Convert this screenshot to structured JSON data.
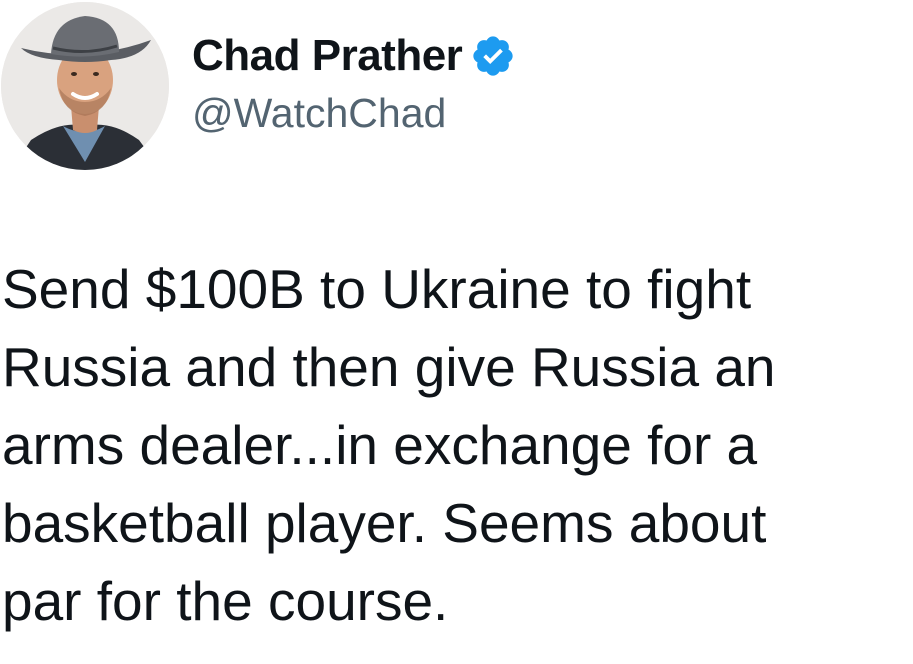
{
  "author": {
    "display_name": "Chad Prather",
    "handle": "@WatchChad",
    "verified": true,
    "verified_icon": "verified-badge-icon",
    "verified_color": "#1d9bf0"
  },
  "tweet": {
    "lines": [
      "Send $100B to Ukraine to fight",
      "Russia and then give Russia an",
      "arms dealer...in exchange for a",
      "basketball player. Seems about",
      "par for the course."
    ]
  }
}
